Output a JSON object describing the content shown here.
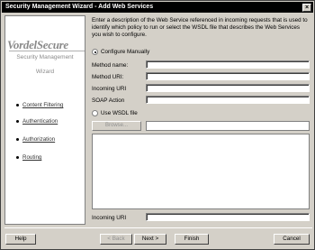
{
  "window": {
    "title": "Security Management Wizard -   Add Web Services",
    "close_glyph": "×"
  },
  "sidebar": {
    "logo": "VordelSecure",
    "subtitle_line1": "Security Management",
    "subtitle_line2": "Wizard",
    "items": [
      {
        "label": "Content Filtering"
      },
      {
        "label": "Authentication"
      },
      {
        "label": "Authorization"
      },
      {
        "label": "Routing"
      }
    ]
  },
  "main": {
    "description": "Enter a description of the Web Service referenced in incoming requests that is used to identify which policy to run or select the WSDL file that describes the Web Services you wish to configure.",
    "configure_manually_label": "Configure Manually",
    "configure_manually_selected": true,
    "fields": {
      "method_name_label": "Method name:",
      "method_uri_label": "Method URI:",
      "incoming_uri_label": "Incoming URI",
      "soap_action_label": "SOAP Action",
      "method_name_value": "",
      "method_uri_value": "",
      "incoming_uri_value": "",
      "soap_action_value": ""
    },
    "use_wsdl_label": "Use WSDL file",
    "use_wsdl_selected": false,
    "browse_label": "Browse...",
    "wsdl_path_value": "",
    "bottom_incoming_uri_label": "Incoming URI",
    "bottom_incoming_uri_value": ""
  },
  "footer": {
    "help_label": "Help",
    "back_label": "< Back",
    "next_label": "Next >",
    "finish_label": "Finish",
    "cancel_label": "Cancel"
  }
}
